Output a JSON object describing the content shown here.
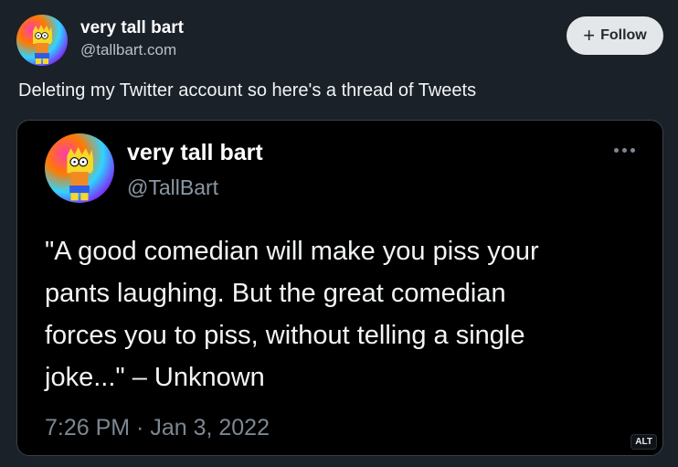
{
  "post": {
    "author_name": "very tall bart",
    "author_handle": "@tallbart.com",
    "follow_plus": "+",
    "follow_label": "Follow",
    "text": "Deleting my Twitter account so here's a thread of Tweets"
  },
  "embed": {
    "author_name": "very tall bart",
    "author_handle": "@TallBart",
    "quote_lines": [
      "\"A good comedian will make you piss your",
      "pants laughing. But the great comedian",
      "forces you to piss, without telling a single",
      "joke...\" – Unknown"
    ],
    "timestamp": "7:26 PM · Jan 3, 2022",
    "alt_badge": "ALT",
    "more_icon": "more-horizontal-icon"
  },
  "colors": {
    "background": "#1a2129",
    "card_background": "#000000",
    "follow_button": "#e4e7ea",
    "muted_text": "#8b98a5"
  }
}
